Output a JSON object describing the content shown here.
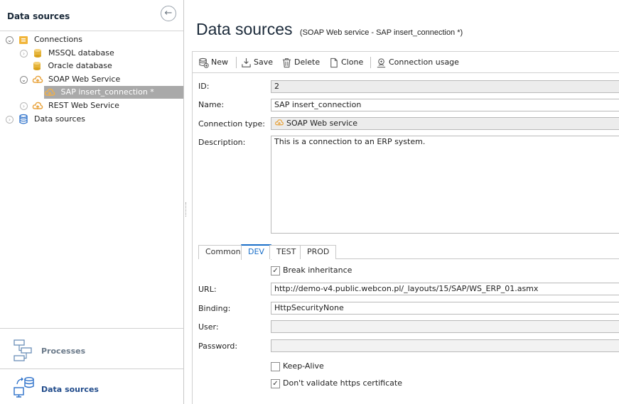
{
  "left_panel": {
    "title": "Data sources",
    "tree": [
      {
        "label": "Connections",
        "expander": "⌄"
      },
      {
        "label": "MSSQL database",
        "expander": "›"
      },
      {
        "label": "Oracle database",
        "expander": ""
      },
      {
        "label": "SOAP Web Service",
        "expander": "⌄"
      },
      {
        "label": "SAP insert_connection *",
        "expander": ""
      },
      {
        "label": "REST Web Service",
        "expander": "›"
      },
      {
        "label": "Data sources",
        "expander": "›"
      }
    ]
  },
  "bottom_nav": {
    "processes": "Processes",
    "data_sources": "Data sources"
  },
  "main": {
    "title": "Data sources",
    "subtitle": "(SOAP Web service - SAP insert_connection *)"
  },
  "toolbar": {
    "new": "New",
    "save": "Save",
    "delete": "Delete",
    "clone": "Clone",
    "connection_usage": "Connection usage"
  },
  "form": {
    "id_label": "ID:",
    "id_value": "2",
    "name_label": "Name:",
    "name_value": "SAP insert_connection",
    "type_label": "Connection type:",
    "type_value": "SOAP Web service",
    "description_label": "Description:",
    "description_value": "This is a connection to an ERP system."
  },
  "tabs": [
    "Common",
    "DEV",
    "TEST",
    "PROD"
  ],
  "active_tab": "DEV",
  "env": {
    "break_inheritance": "Break inheritance",
    "break_inheritance_checked": true,
    "url_label": "URL:",
    "url_value": "http://demo-v4.public.webcon.pl/_layouts/15/SAP/WS_ERP_01.asmx",
    "binding_label": "Binding:",
    "binding_value": "HttpSecurityNone",
    "user_label": "User:",
    "user_value": "",
    "password_label": "Password:",
    "password_value": "",
    "keep_alive": "Keep-Alive",
    "keep_alive_checked": false,
    "dont_validate": "Don't validate https certificate",
    "dont_validate_checked": true
  },
  "colors": {
    "accent": "#1a6fc9",
    "selected_row": "#a9a9a9",
    "db_icon": "#d9a21b",
    "soap_icon": "#e8a23a",
    "nav_icon": "#2a6fc9"
  }
}
